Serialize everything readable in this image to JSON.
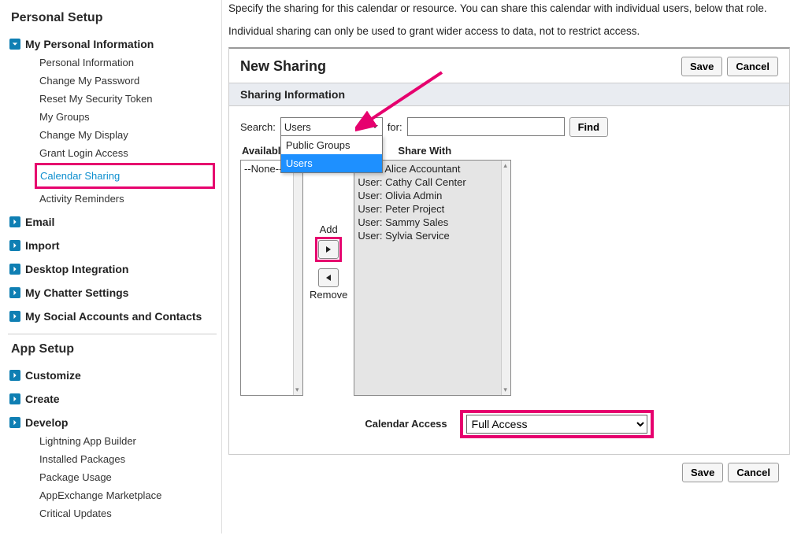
{
  "sidebar": {
    "personal_setup_title": "Personal Setup",
    "app_setup_title": "App Setup",
    "sections": {
      "my_personal_info": {
        "label": "My Personal Information",
        "items": [
          "Personal Information",
          "Change My Password",
          "Reset My Security Token",
          "My Groups",
          "Change My Display",
          "Grant Login Access",
          "Calendar Sharing",
          "Activity Reminders"
        ]
      },
      "email": {
        "label": "Email"
      },
      "import": {
        "label": "Import"
      },
      "desktop": {
        "label": "Desktop Integration"
      },
      "chatter": {
        "label": "My Chatter Settings"
      },
      "social": {
        "label": "My Social Accounts and Contacts"
      },
      "customize": {
        "label": "Customize"
      },
      "create": {
        "label": "Create"
      },
      "develop": {
        "label": "Develop",
        "items": [
          "Lightning App Builder",
          "Installed Packages",
          "Package Usage",
          "AppExchange Marketplace",
          "Critical Updates"
        ]
      }
    }
  },
  "main": {
    "intro1": "Specify the sharing for this calendar or resource. You can share this calendar with individual users, below that role.",
    "intro2": "Individual sharing can only be used to grant wider access to data, not to restrict access.",
    "card_title": "New Sharing",
    "section_title": "Sharing Information",
    "buttons": {
      "save": "Save",
      "cancel": "Cancel",
      "find": "Find",
      "add": "Add",
      "remove": "Remove"
    },
    "search_label": "Search:",
    "search_select_value": "Users",
    "search_options": [
      "Public Groups",
      "Users"
    ],
    "for_label": "for:",
    "for_value": "",
    "available_label": "Available",
    "share_with_label": "Share With",
    "available_items": [
      "--None--"
    ],
    "share_with_items": [
      "User: Alice Accountant",
      "User: Cathy Call Center",
      "User: Olivia Admin",
      "User: Peter Project",
      "User: Sammy Sales",
      "User: Sylvia Service"
    ],
    "access_label": "Calendar Access",
    "access_value": "Full Access"
  }
}
